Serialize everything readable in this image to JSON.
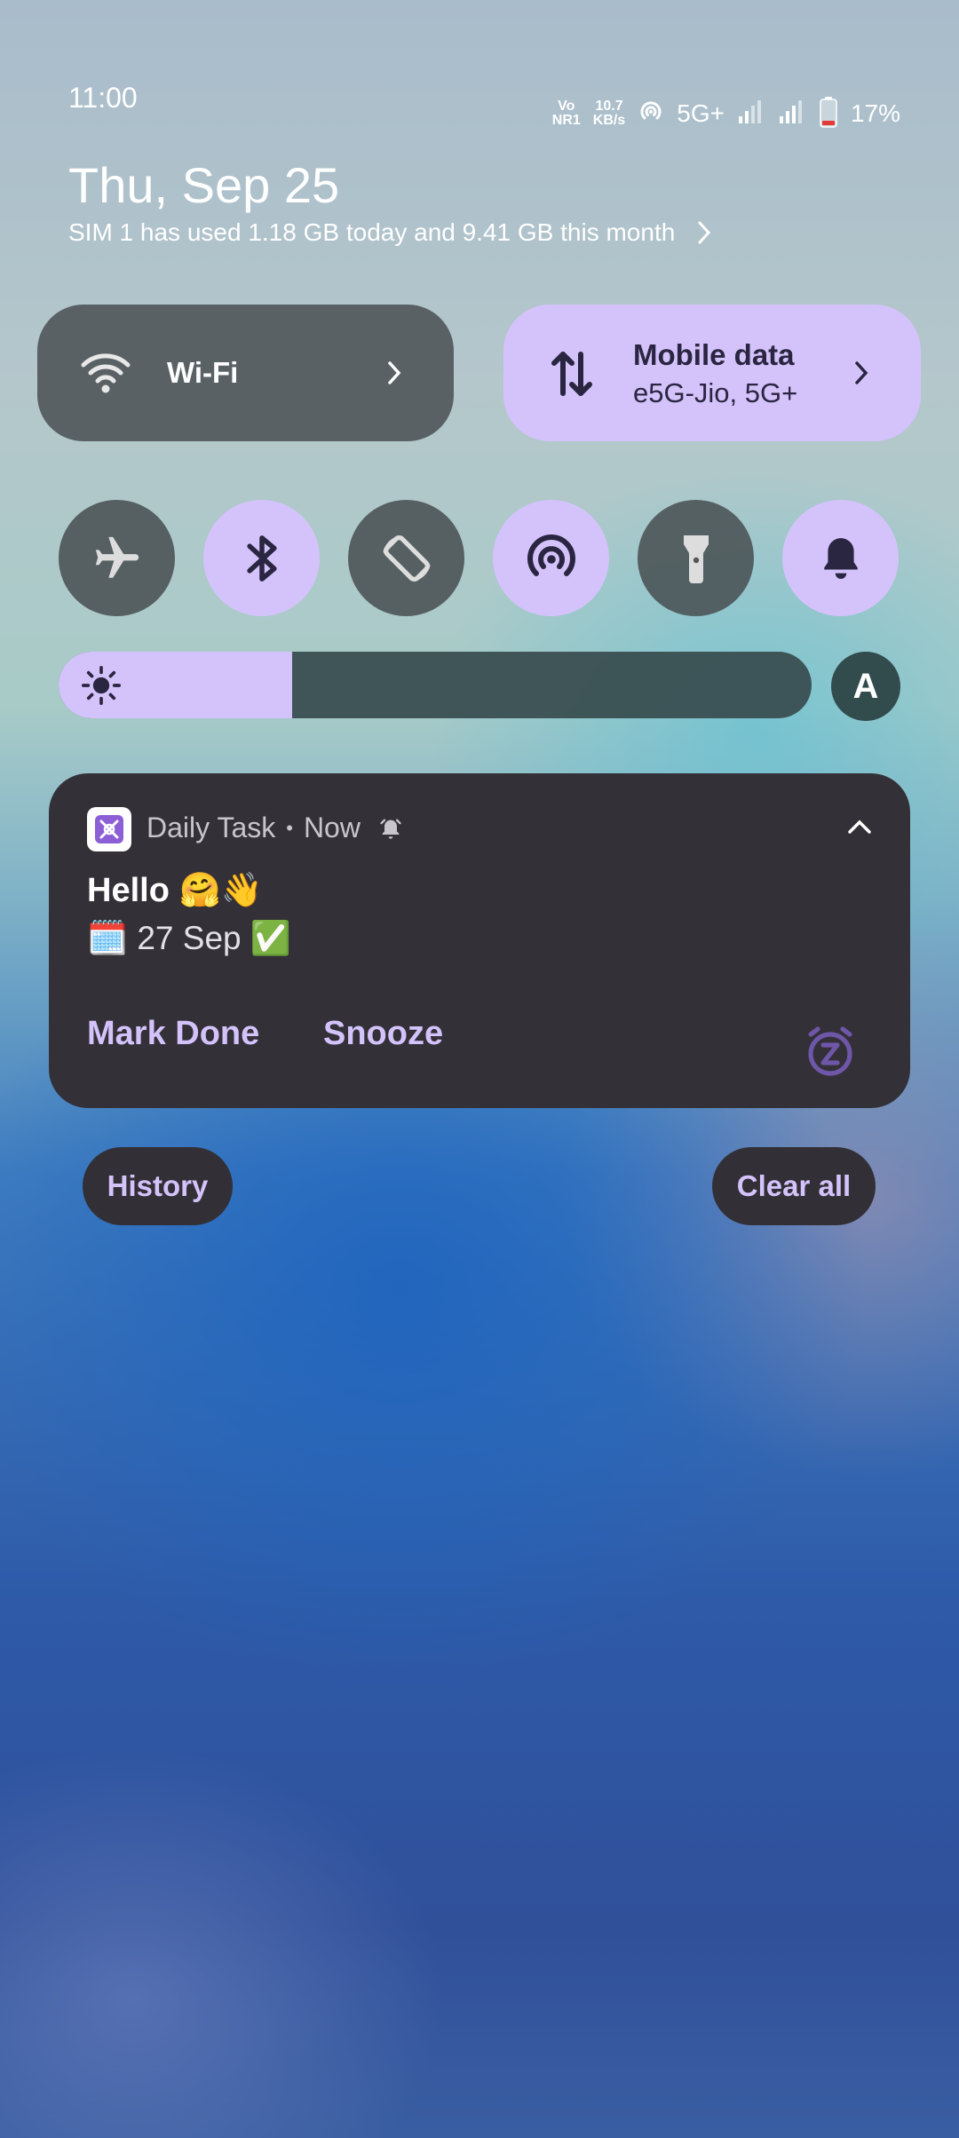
{
  "status_bar": {
    "time": "11:00",
    "volte_top": "Vo",
    "volte_bottom": "NR1",
    "speed_value": "10.7",
    "speed_unit": "KB/s",
    "network_type": "5G+",
    "battery_percent": "17%",
    "battery_level": 0.17
  },
  "header": {
    "date": "Thu, Sep 25",
    "data_usage": "SIM 1 has used 1.18 GB today and 9.41 GB this month"
  },
  "tiles": {
    "wifi": {
      "label": "Wi-Fi",
      "active": false
    },
    "mobile_data": {
      "label": "Mobile data",
      "sublabel": "e5G-Jio, 5G+",
      "active": true
    }
  },
  "toggles": [
    {
      "name": "airplane-mode-icon",
      "active": false
    },
    {
      "name": "bluetooth-icon",
      "active": true
    },
    {
      "name": "auto-rotate-icon",
      "active": false
    },
    {
      "name": "hotspot-icon",
      "active": true
    },
    {
      "name": "flashlight-icon",
      "active": false
    },
    {
      "name": "sound-bell-icon",
      "active": true
    }
  ],
  "brightness": {
    "level": 0.31,
    "auto_label": "A"
  },
  "notification": {
    "app_name": "Daily Task",
    "separator": "•",
    "time": "Now",
    "title": "Hello 🤗👋",
    "body": "🗓️ 27 Sep  ✅",
    "actions": [
      "Mark Done",
      "Snooze"
    ]
  },
  "buttons": {
    "history": "History",
    "clear_all": "Clear all"
  },
  "colors": {
    "accent": "#d4c3fb",
    "card": "#333037",
    "tile_off": "#464b4e"
  }
}
